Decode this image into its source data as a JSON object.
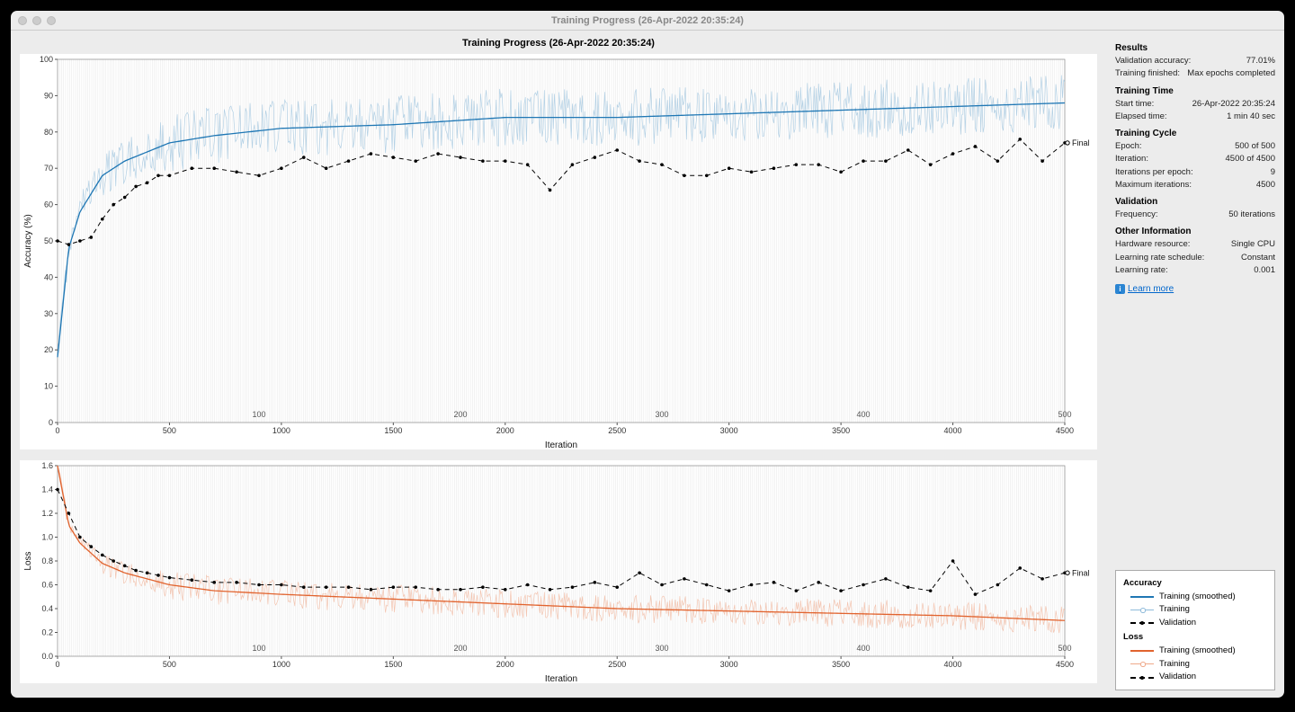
{
  "window_title": "Training Progress (26-Apr-2022 20:35:24)",
  "chart_title": "Training Progress (26-Apr-2022 20:35:24)",
  "final_label": "Final",
  "learn_more": "Learn more",
  "side": {
    "results_h": "Results",
    "val_acc_k": "Validation accuracy:",
    "val_acc_v": "77.01%",
    "train_fin_k": "Training finished:",
    "train_fin_v": "Max epochs completed",
    "time_h": "Training Time",
    "start_k": "Start time:",
    "start_v": "26-Apr-2022 20:35:24",
    "elapsed_k": "Elapsed time:",
    "elapsed_v": "1 min 40 sec",
    "cycle_h": "Training Cycle",
    "epoch_k": "Epoch:",
    "epoch_v": "500 of 500",
    "iter_k": "Iteration:",
    "iter_v": "4500 of 4500",
    "ipe_k": "Iterations per epoch:",
    "ipe_v": "9",
    "maxit_k": "Maximum iterations:",
    "maxit_v": "4500",
    "valid_h": "Validation",
    "freq_k": "Frequency:",
    "freq_v": "50 iterations",
    "other_h": "Other Information",
    "hw_k": "Hardware resource:",
    "hw_v": "Single CPU",
    "lrs_k": "Learning rate schedule:",
    "lrs_v": "Constant",
    "lr_k": "Learning rate:",
    "lr_v": "0.001"
  },
  "legend": {
    "acc_h": "Accuracy",
    "loss_h": "Loss",
    "smoothed": "Training (smoothed)",
    "training": "Training",
    "validation": "Validation"
  },
  "chart_data": [
    {
      "type": "line",
      "title": "Accuracy (%)",
      "xlabel": "Iteration",
      "ylabel": "Accuracy (%)",
      "xlim": [
        0,
        4500
      ],
      "ylim": [
        0,
        100
      ],
      "epoch_ticks": [
        100,
        200,
        300,
        400,
        500
      ],
      "series": [
        {
          "name": "Training",
          "x": "0..4500",
          "description": "noisy raw training accuracy, light blue, oscillating roughly ±8 around smoothed curve"
        },
        {
          "name": "Training (smoothed)",
          "x": [
            0,
            50,
            100,
            200,
            300,
            500,
            700,
            1000,
            1500,
            2000,
            2500,
            3000,
            3500,
            4000,
            4500
          ],
          "values": [
            18,
            48,
            58,
            68,
            72,
            77,
            79,
            81,
            82,
            84,
            84,
            85,
            86,
            87,
            88
          ]
        },
        {
          "name": "Validation",
          "x": [
            0,
            50,
            100,
            150,
            200,
            250,
            300,
            350,
            400,
            450,
            500,
            600,
            700,
            800,
            900,
            1000,
            1100,
            1200,
            1300,
            1400,
            1500,
            1600,
            1700,
            1800,
            1900,
            2000,
            2100,
            2200,
            2300,
            2400,
            2500,
            2600,
            2700,
            2800,
            2900,
            3000,
            3100,
            3200,
            3300,
            3400,
            3500,
            3600,
            3700,
            3800,
            3900,
            4000,
            4100,
            4200,
            4300,
            4400,
            4500
          ],
          "values": [
            50,
            49,
            50,
            51,
            56,
            60,
            62,
            65,
            66,
            68,
            68,
            70,
            70,
            69,
            68,
            70,
            73,
            70,
            72,
            74,
            73,
            72,
            74,
            73,
            72,
            72,
            71,
            64,
            71,
            73,
            75,
            72,
            71,
            68,
            68,
            70,
            69,
            70,
            71,
            71,
            69,
            72,
            72,
            75,
            71,
            74,
            76,
            72,
            78,
            72,
            77
          ]
        }
      ]
    },
    {
      "type": "line",
      "title": "Loss",
      "xlabel": "Iteration",
      "ylabel": "Loss",
      "xlim": [
        0,
        4500
      ],
      "ylim": [
        0,
        1.6
      ],
      "epoch_ticks": [
        100,
        200,
        300,
        400,
        500
      ],
      "series": [
        {
          "name": "Training",
          "x": "0..4500",
          "description": "noisy raw training loss, light orange, oscillating roughly ±0.12 around smoothed curve"
        },
        {
          "name": "Training (smoothed)",
          "x": [
            0,
            50,
            100,
            200,
            300,
            500,
            700,
            1000,
            1500,
            2000,
            2500,
            3000,
            3500,
            4000,
            4500
          ],
          "values": [
            1.6,
            1.1,
            0.95,
            0.78,
            0.7,
            0.6,
            0.55,
            0.52,
            0.48,
            0.44,
            0.4,
            0.38,
            0.36,
            0.34,
            0.3
          ]
        },
        {
          "name": "Validation",
          "x": [
            0,
            50,
            100,
            150,
            200,
            250,
            300,
            350,
            400,
            450,
            500,
            600,
            700,
            800,
            900,
            1000,
            1100,
            1200,
            1300,
            1400,
            1500,
            1600,
            1700,
            1800,
            1900,
            2000,
            2100,
            2200,
            2300,
            2400,
            2500,
            2600,
            2700,
            2800,
            2900,
            3000,
            3100,
            3200,
            3300,
            3400,
            3500,
            3600,
            3700,
            3800,
            3900,
            4000,
            4100,
            4200,
            4300,
            4400,
            4500
          ],
          "values": [
            1.4,
            1.2,
            1.0,
            0.92,
            0.85,
            0.8,
            0.76,
            0.72,
            0.7,
            0.68,
            0.66,
            0.64,
            0.62,
            0.62,
            0.6,
            0.6,
            0.58,
            0.58,
            0.58,
            0.56,
            0.58,
            0.58,
            0.56,
            0.56,
            0.58,
            0.56,
            0.6,
            0.56,
            0.58,
            0.62,
            0.58,
            0.7,
            0.6,
            0.65,
            0.6,
            0.55,
            0.6,
            0.62,
            0.55,
            0.62,
            0.55,
            0.6,
            0.65,
            0.58,
            0.55,
            0.8,
            0.52,
            0.6,
            0.74,
            0.65,
            0.7
          ]
        }
      ]
    }
  ]
}
